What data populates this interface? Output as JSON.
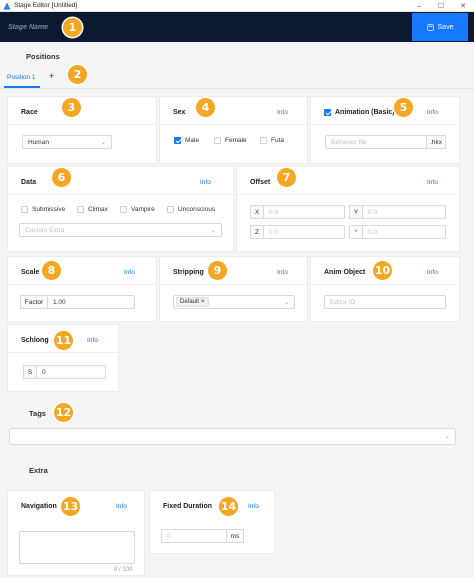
{
  "window": {
    "title": "Stage Editor [Untitled]",
    "minimize": "–",
    "maximize": "☐",
    "close": "✕"
  },
  "header": {
    "stage_name": "Stage Name",
    "save_label": "Save"
  },
  "badges": [
    "1",
    "2",
    "3",
    "4",
    "5",
    "6",
    "7",
    "8",
    "9",
    "10",
    "11",
    "12",
    "13",
    "14"
  ],
  "positions": {
    "label": "Positions",
    "tab": "Position 1",
    "add": "+"
  },
  "race": {
    "title": "Race",
    "value": "Human"
  },
  "sex": {
    "title": "Sex",
    "info": "Info",
    "options": [
      "Male",
      "Female",
      "Futa"
    ]
  },
  "animation": {
    "title": "Animation (Basic)",
    "info": "Info",
    "placeholder": "Behavior file",
    "suffix": ".hkx"
  },
  "data": {
    "title": "Data",
    "info": "Info",
    "options": [
      "Submissive",
      "Climax",
      "Vampire",
      "Unconscious"
    ],
    "custom_placeholder": "Custom Extra"
  },
  "offset": {
    "title": "Offset",
    "info": "Info",
    "x_label": "X",
    "y_label": "Y",
    "z_label": "Z",
    "r_label": "°",
    "x": "0.0",
    "y": "0.0",
    "z": "0.0",
    "r": "0.0"
  },
  "scale": {
    "title": "Scale",
    "info": "Info",
    "factor_label": "Factor",
    "factor_value": "1.00"
  },
  "stripping": {
    "title": "Stripping",
    "info": "Info",
    "tag": "Default",
    "tag_close": "×"
  },
  "anim_object": {
    "title": "Anim Object",
    "info": "Info",
    "placeholder": "Editor ID"
  },
  "schlong": {
    "title": "Schlong",
    "info": "Info",
    "label": "S",
    "value": "0"
  },
  "tags": {
    "label": "Tags"
  },
  "extra": {
    "label": "Extra"
  },
  "navigation": {
    "title": "Navigation",
    "info": "Info",
    "counter": "0 / 100"
  },
  "fixed_duration": {
    "title": "Fixed Duration",
    "info": "Info",
    "value": "0",
    "unit": "ms"
  },
  "colors": {
    "accent": "#1677ff",
    "header_bg": "#0b1a30",
    "badge": "#f5a623"
  }
}
